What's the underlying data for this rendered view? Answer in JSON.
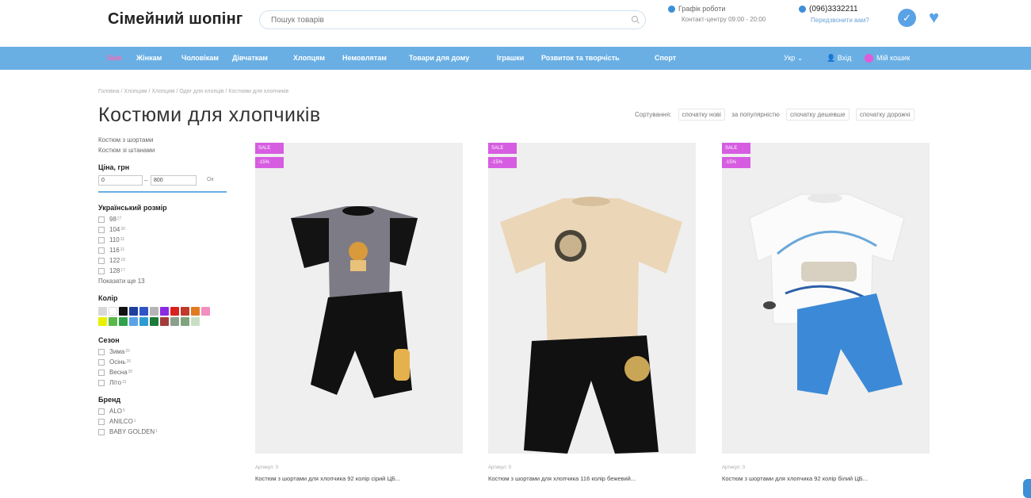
{
  "header": {
    "logo": "Сімейний шопінг",
    "search_placeholder": "Пошук товарів",
    "schedule_title": "Графік роботи",
    "schedule_hours": "Контакт-центру 09:00 - 20:00",
    "phone": "(096)3332211",
    "callback": "Передзвонити вам?"
  },
  "nav": {
    "items": [
      "Sale",
      "Жінкам",
      "Чоловікам",
      "Дівчаткам",
      "Хлопцям",
      "Немовлятам",
      "Товари для дому",
      "Іграшки",
      "Розвиток та творчість",
      "Спорт"
    ],
    "lang": "Укр",
    "login": "Вхід",
    "cart": "Мій кошик"
  },
  "breadcrumb": "Головна  /  Хлопцям  /  Хлопцям  /  Одяг для хлопців  /  Костюми для хлопчиків",
  "page_title": "Костюми для хлопчиків",
  "sort": {
    "label": "Сортування:",
    "options": [
      "спочатку нові",
      "за популярністю",
      "спочатку дешевше",
      "спочатку дорожчі"
    ]
  },
  "sidebar": {
    "links": [
      "Костюм з шортами",
      "Костюм зі штанами"
    ],
    "price": {
      "title": "Ціна, грн",
      "min": "0",
      "max": "800",
      "ok": "Ок"
    },
    "size": {
      "title": "Український розмір",
      "items": [
        {
          "label": "98",
          "count": "27"
        },
        {
          "label": "104",
          "count": "30"
        },
        {
          "label": "110",
          "count": "31"
        },
        {
          "label": "116",
          "count": "31"
        },
        {
          "label": "122",
          "count": "18"
        },
        {
          "label": "128",
          "count": "17"
        }
      ],
      "show_all": "Показати ще 13"
    },
    "color": {
      "title": "Колір",
      "swatches": [
        "#d8d8d8",
        "#ffffff",
        "#111111",
        "#1f3f9e",
        "#2f56c8",
        "#b5b5b5",
        "#8a2be2",
        "#d9221f",
        "#c0392b",
        "#e07b20",
        "#f28ec0",
        "#e9f000",
        "#59b84a",
        "#2fa24a",
        "#5aa2e6",
        "#2a9cd1",
        "#1d7a3a",
        "#a33b3b",
        "#8aa08a",
        "#7ea37e",
        "#c9dfc4"
      ]
    },
    "season": {
      "title": "Сезон",
      "items": [
        {
          "label": "Зима",
          "count": "20"
        },
        {
          "label": "Осінь",
          "count": "26"
        },
        {
          "label": "Весна",
          "count": "30"
        },
        {
          "label": "Літо",
          "count": "31"
        }
      ]
    },
    "brand": {
      "title": "Бренд",
      "items": [
        {
          "label": "ALO",
          "count": "5"
        },
        {
          "label": "ANILCO",
          "count": "1"
        },
        {
          "label": "BABY GOLDEN",
          "count": "1"
        }
      ]
    }
  },
  "products": [
    {
      "sale": "SALE",
      "discount": "-15%",
      "article": "Артикул: 0",
      "name": "Костюм з шортами для хлопчика 92 колір сірий ЦБ..."
    },
    {
      "sale": "SALE",
      "discount": "-15%",
      "article": "Артикул: 0",
      "name": "Костюм з шортами для хлопчика 116 колір бежевий..."
    },
    {
      "sale": "SALE",
      "discount": "-15%",
      "article": "Артикул: 0",
      "name": "Костюм з шортами для хлопчика 92 колір білий ЦБ..."
    }
  ]
}
